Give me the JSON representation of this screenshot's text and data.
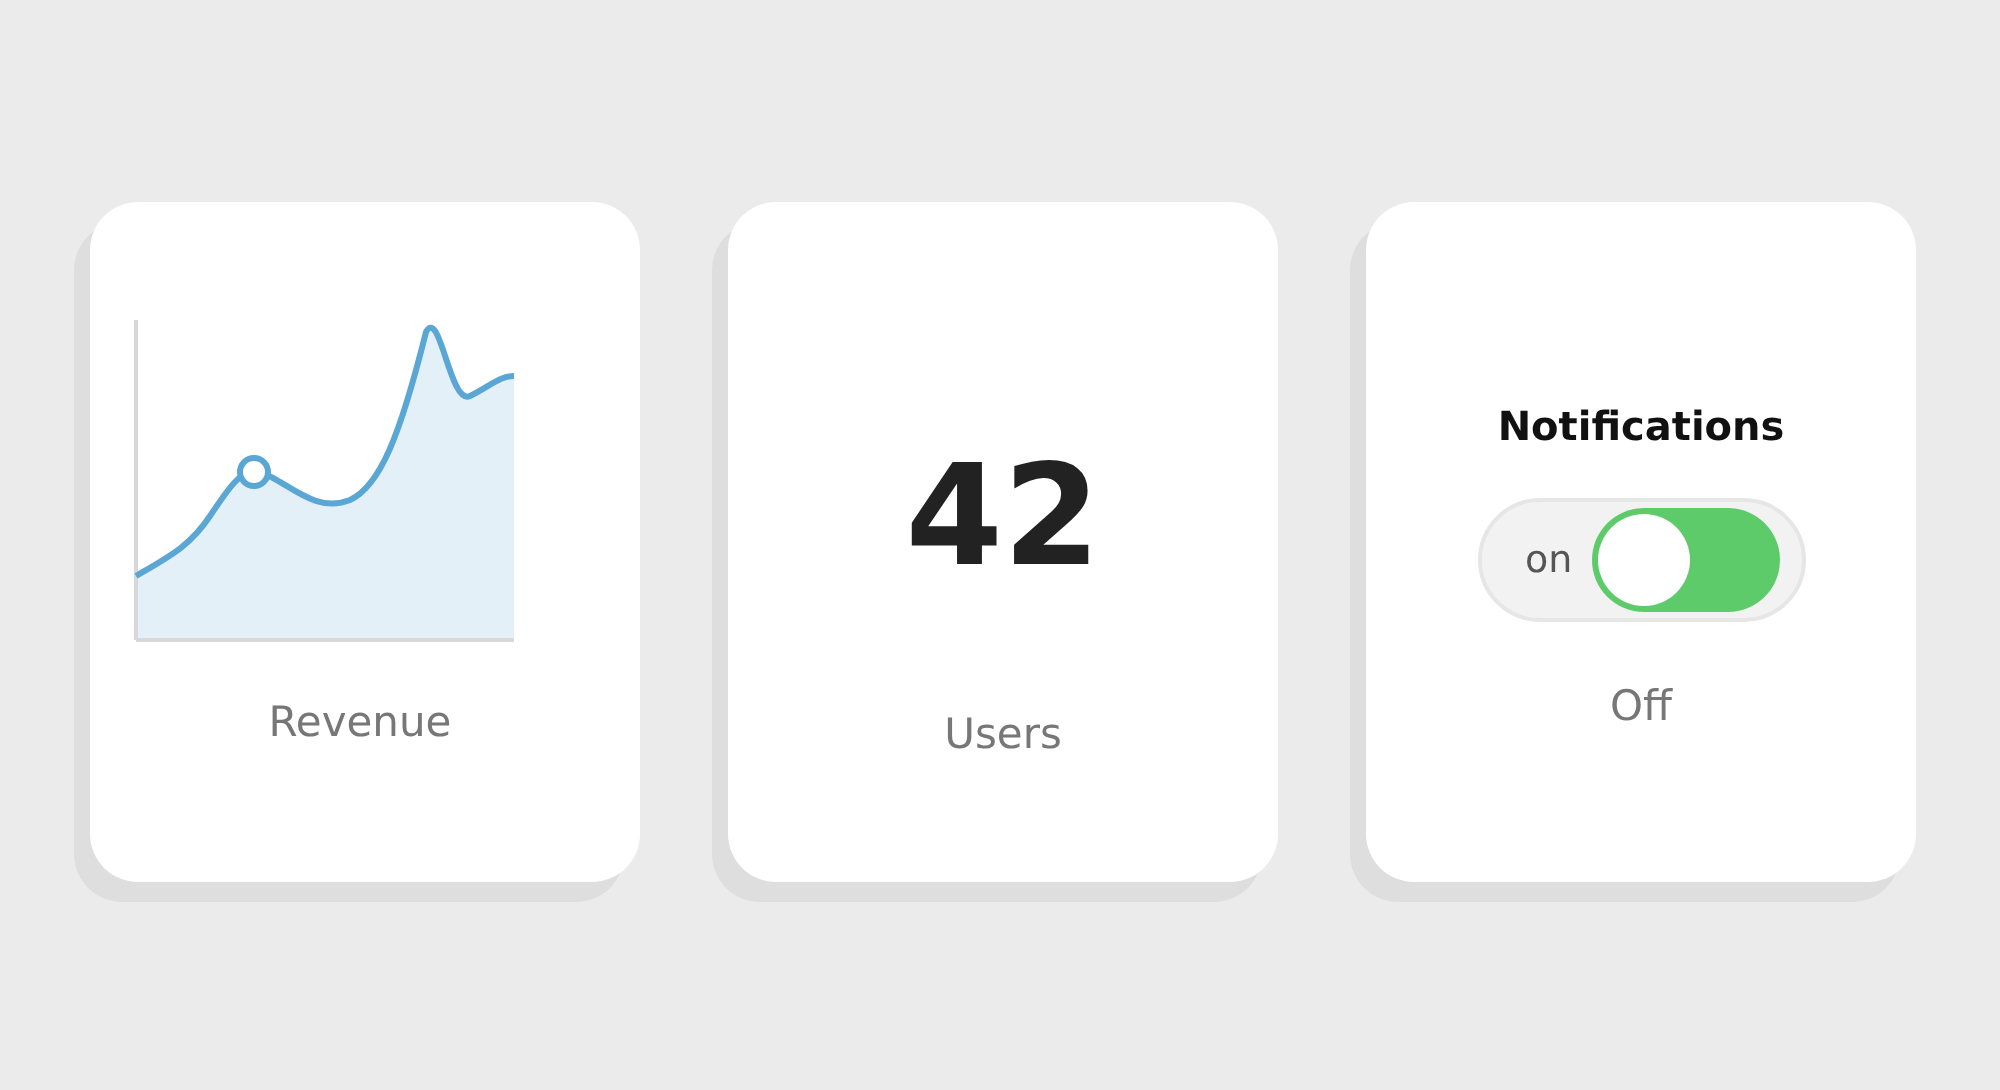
{
  "cards": [
    {
      "kind": "chart",
      "label": "Revenue"
    },
    {
      "kind": "stat",
      "value": "42",
      "label": "Users"
    },
    {
      "kind": "toggle",
      "title": "Notifications",
      "toggle_text": "on",
      "on": true,
      "label": "Off"
    }
  ]
}
